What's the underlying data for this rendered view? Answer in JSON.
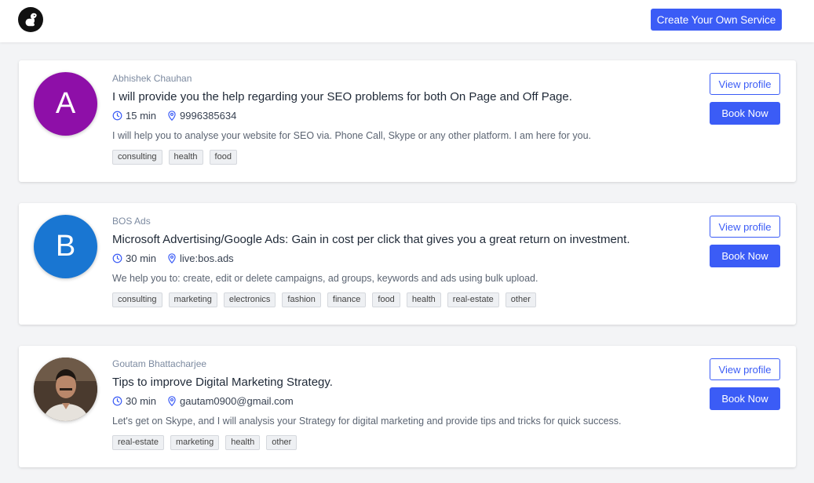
{
  "header": {
    "logo_icon": "squirrel-logo-icon",
    "create_label": "Create Your Own Service",
    "accent": "#3b5cf6"
  },
  "services": [
    {
      "avatar_letter": "A",
      "avatar_color": "#8e0fa8",
      "host": "Abhishek Chauhan",
      "title": "I will provide you the help regarding your SEO problems for both On Page and Off Page.",
      "duration": "15 min",
      "location": "9996385634",
      "description": "I will help you to analyse your website for SEO via. Phone Call, Skype or any other platform. I am here for you.",
      "tags": [
        "consulting",
        "health",
        "food"
      ],
      "view_label": "View profile",
      "book_label": "Book Now"
    },
    {
      "avatar_letter": "B",
      "avatar_color": "#1976d2",
      "host": "BOS Ads",
      "title": "Microsoft Advertising/Google Ads: Gain in cost per click that gives you a great return on investment.",
      "duration": "30 min",
      "location": "live:bos.ads",
      "description": "We help you to: create, edit or delete campaigns, ad groups, keywords and ads using bulk upload.",
      "tags": [
        "consulting",
        "marketing",
        "electronics",
        "fashion",
        "finance",
        "food",
        "health",
        "real-estate",
        "other"
      ],
      "view_label": "View profile",
      "book_label": "Book Now"
    },
    {
      "avatar_letter": "",
      "avatar_color": "#6b5a4a",
      "host": "Goutam Bhattacharjee",
      "title": "Tips to improve Digital Marketing Strategy.",
      "duration": "30 min",
      "location": "gautam0900@gmail.com",
      "description": "Let's get on Skype, and I will analysis your Strategy for digital marketing and provide tips and tricks for quick success.",
      "tags": [
        "real-estate",
        "marketing",
        "health",
        "other"
      ],
      "view_label": "View profile",
      "book_label": "Book Now"
    }
  ]
}
